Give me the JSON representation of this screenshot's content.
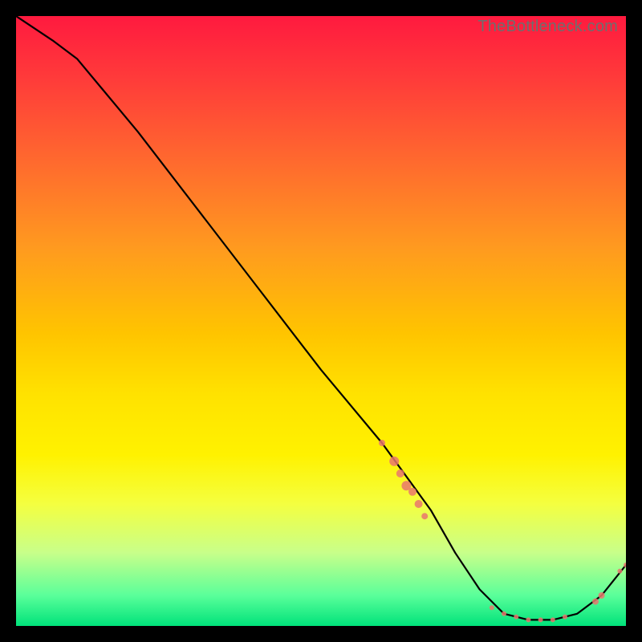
{
  "watermark": "TheBottleneck.com",
  "chart_data": {
    "type": "line",
    "title": "",
    "xlabel": "",
    "ylabel": "",
    "xlim": [
      0,
      100
    ],
    "ylim": [
      0,
      100
    ],
    "series": [
      {
        "name": "bottleneck-curve",
        "x": [
          0,
          6,
          10,
          20,
          30,
          40,
          50,
          60,
          68,
          72,
          76,
          80,
          84,
          88,
          92,
          96,
          100
        ],
        "y": [
          100,
          96,
          93,
          81,
          68,
          55,
          42,
          30,
          19,
          12,
          6,
          2,
          1,
          1,
          2,
          5,
          10
        ]
      }
    ],
    "markers": {
      "name": "sample-points",
      "color": "#e9776d",
      "points": [
        {
          "x": 60,
          "y": 30,
          "r": 4
        },
        {
          "x": 62,
          "y": 27,
          "r": 6
        },
        {
          "x": 63,
          "y": 25,
          "r": 5
        },
        {
          "x": 64,
          "y": 23,
          "r": 6
        },
        {
          "x": 65,
          "y": 22,
          "r": 5
        },
        {
          "x": 66,
          "y": 20,
          "r": 5
        },
        {
          "x": 67,
          "y": 18,
          "r": 4
        },
        {
          "x": 78,
          "y": 3,
          "r": 3
        },
        {
          "x": 80,
          "y": 2,
          "r": 3
        },
        {
          "x": 82,
          "y": 1.5,
          "r": 3
        },
        {
          "x": 84,
          "y": 1,
          "r": 3
        },
        {
          "x": 86,
          "y": 1,
          "r": 3
        },
        {
          "x": 88,
          "y": 1,
          "r": 3
        },
        {
          "x": 90,
          "y": 1.5,
          "r": 3
        },
        {
          "x": 95,
          "y": 4,
          "r": 4
        },
        {
          "x": 96,
          "y": 5,
          "r": 4
        },
        {
          "x": 99,
          "y": 9,
          "r": 3
        },
        {
          "x": 100,
          "y": 10,
          "r": 3
        }
      ]
    }
  }
}
